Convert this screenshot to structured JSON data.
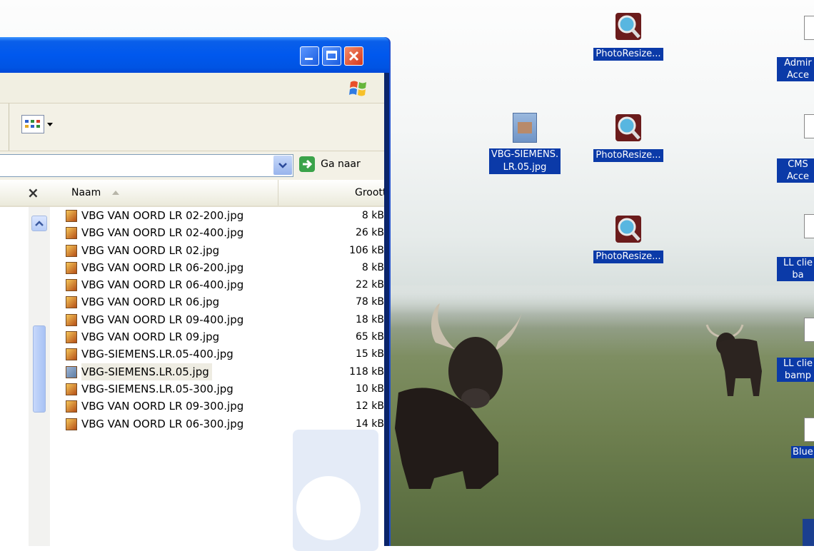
{
  "window": {
    "go_label": "Ga naar",
    "close_pane_label": "×",
    "columns": {
      "name": "Naam",
      "size": "Grootte"
    },
    "files": [
      {
        "name": "VBG VAN OORD LR 02-200.jpg",
        "size": "8 kB"
      },
      {
        "name": "VBG VAN OORD LR 02-400.jpg",
        "size": "26 kB"
      },
      {
        "name": "VBG VAN OORD LR 02.jpg",
        "size": "106 kB"
      },
      {
        "name": "VBG VAN OORD LR 06-200.jpg",
        "size": "8 kB"
      },
      {
        "name": "VBG VAN OORD LR 06-400.jpg",
        "size": "22 kB"
      },
      {
        "name": "VBG VAN OORD LR 06.jpg",
        "size": "78 kB"
      },
      {
        "name": "VBG VAN OORD LR 09-400.jpg",
        "size": "18 kB"
      },
      {
        "name": "VBG VAN OORD LR 09.jpg",
        "size": "65 kB"
      },
      {
        "name": "VBG-SIEMENS.LR.05-400.jpg",
        "size": "15 kB"
      },
      {
        "name": "VBG-SIEMENS.LR.05.jpg",
        "size": "118 kB"
      },
      {
        "name": "VBG-SIEMENS.LR.05-300.jpg",
        "size": "10 kB"
      },
      {
        "name": "VBG VAN OORD LR 09-300.jpg",
        "size": "12 kB"
      },
      {
        "name": "VBG VAN OORD LR 06-300.jpg",
        "size": "14 kB"
      }
    ]
  },
  "desktop": {
    "icons": [
      {
        "label": "PhotoResize..."
      },
      {
        "label": "VBG-SIEMENS.\nLR.05.jpg"
      },
      {
        "label": "PhotoResize..."
      },
      {
        "label": "PhotoResize..."
      }
    ],
    "right_labels": [
      {
        "l1": "Admir",
        "l2": "Acce"
      },
      {
        "l1": "CMS",
        "l2": "Acce"
      },
      {
        "l1": "LL clie",
        "l2": "ba"
      },
      {
        "l1": "LL clie",
        "l2": "bamp"
      },
      {
        "l1": "Blue",
        "l2": ""
      }
    ]
  }
}
